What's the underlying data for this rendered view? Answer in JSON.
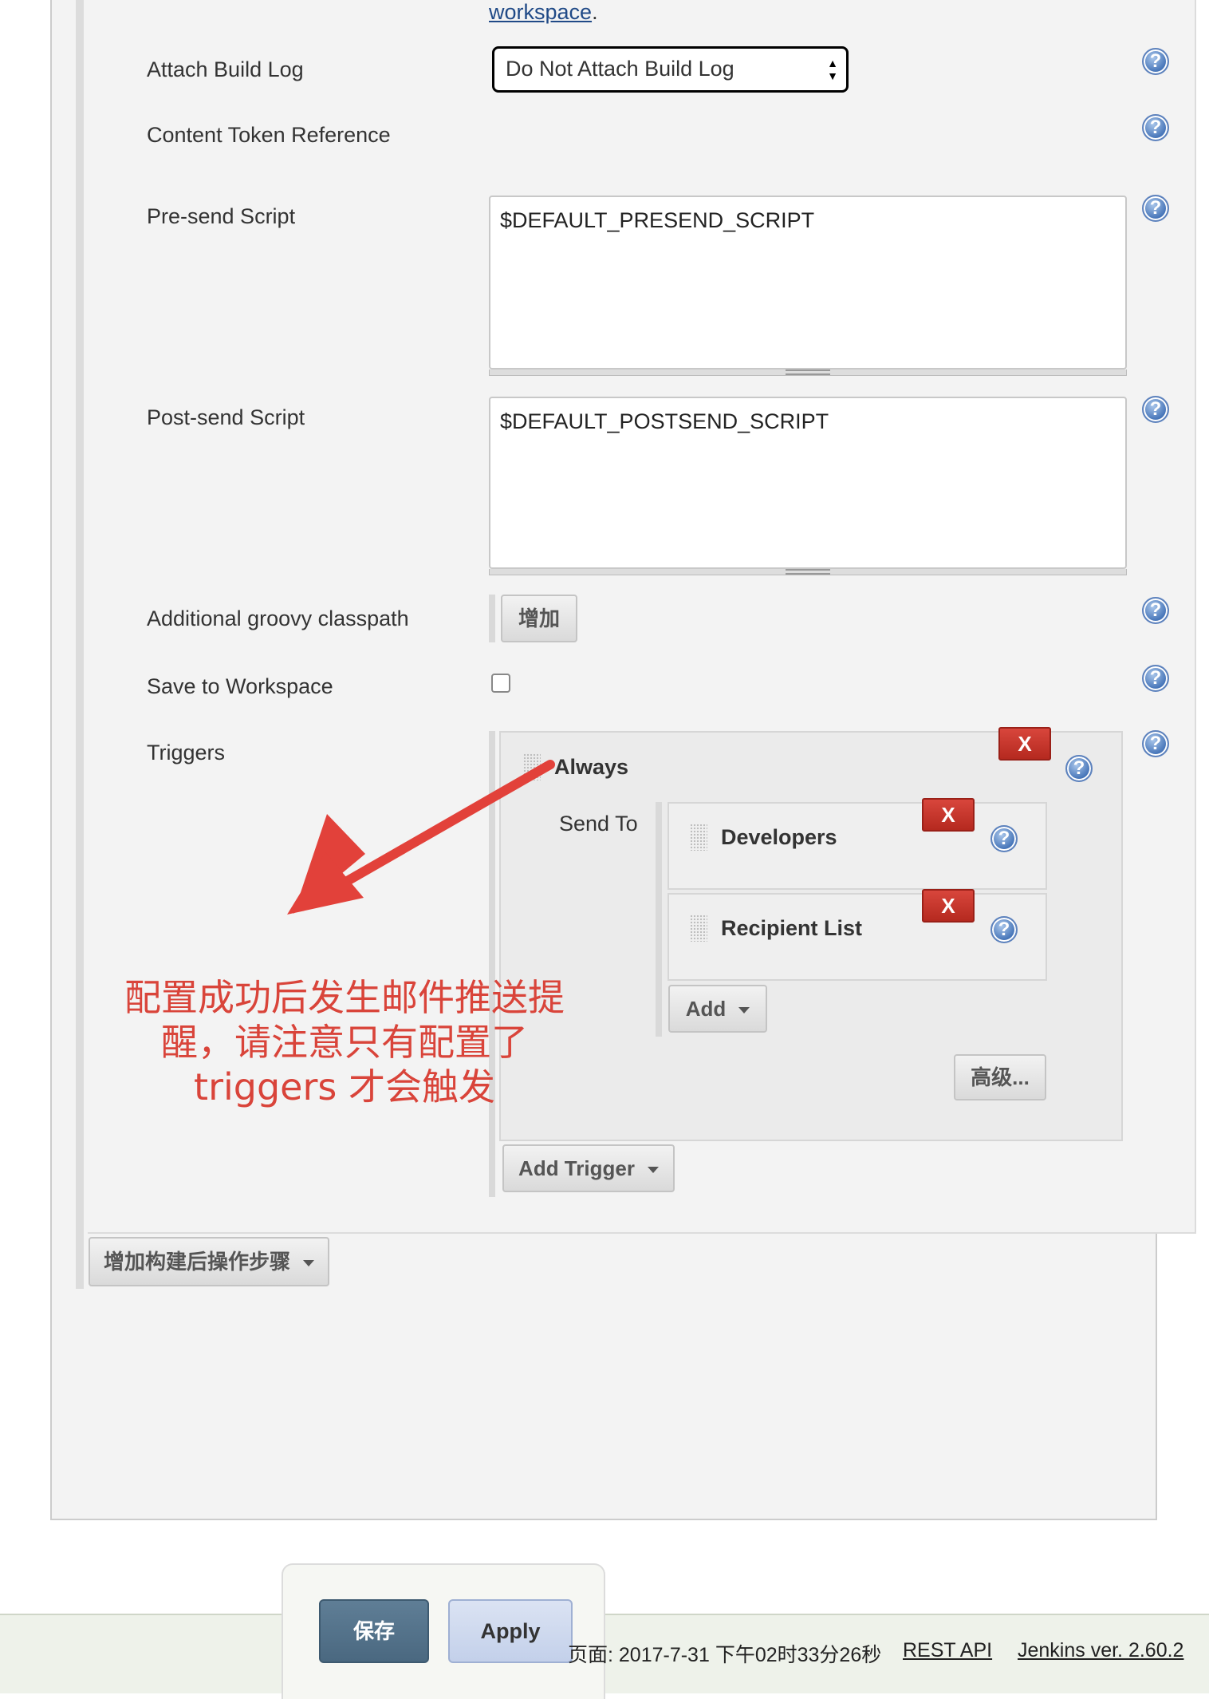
{
  "top_link": {
    "text": "workspace",
    "suffix": "."
  },
  "fields": {
    "attach_build_log": {
      "label": "Attach Build Log",
      "value": "Do Not Attach Build Log"
    },
    "content_token_reference": {
      "label": "Content Token Reference"
    },
    "pre_send_script": {
      "label": "Pre-send Script",
      "value": "$DEFAULT_PRESEND_SCRIPT"
    },
    "post_send_script": {
      "label": "Post-send Script",
      "value": "$DEFAULT_POSTSEND_SCRIPT"
    },
    "additional_groovy_classpath": {
      "label": "Additional groovy classpath",
      "button": "增加"
    },
    "save_to_workspace": {
      "label": "Save to Workspace",
      "checked": false
    },
    "triggers": {
      "label": "Triggers"
    }
  },
  "trigger": {
    "name": "Always",
    "send_to_label": "Send To",
    "recipients": [
      {
        "name": "Developers"
      },
      {
        "name": "Recipient List"
      }
    ],
    "add_label": "Add",
    "advanced_label": "高级...",
    "delete_label": "X"
  },
  "add_trigger_label": "Add Trigger",
  "add_post_build_label": "增加构建后操作步骤",
  "help_glyph": "?",
  "annotation": {
    "text": "配置成功后发生邮件推送提醒，请注意只有配置了 triggers 才会触发",
    "color": "#d9443a"
  },
  "buttons": {
    "save": "保存",
    "apply": "Apply"
  },
  "footer": {
    "page_generated": "页面: 2017-7-31 下午02时33分26秒",
    "rest_api": "REST API",
    "jenkins_version": "Jenkins ver. 2.60.2"
  }
}
